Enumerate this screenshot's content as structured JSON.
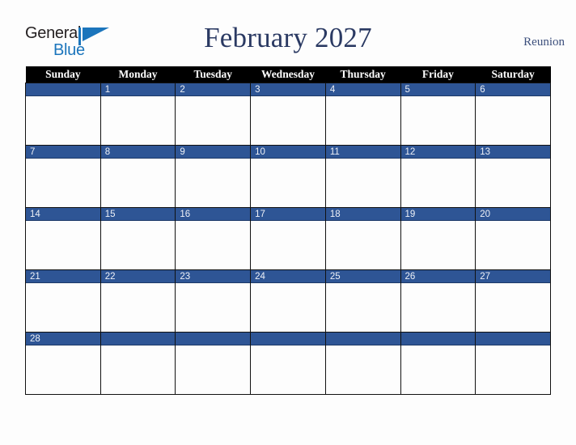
{
  "brand": {
    "word_one": "General",
    "word_two": "Blue",
    "triangle_icon": "triangle-icon",
    "color_dark": "#231f20",
    "color_blue": "#1b75bc"
  },
  "header": {
    "title": "February 2027",
    "month": "February",
    "year": "2027",
    "locale": "Reunion",
    "title_color": "#2b3a63"
  },
  "calendar": {
    "weekday_headers": [
      "Sunday",
      "Monday",
      "Tuesday",
      "Wednesday",
      "Thursday",
      "Friday",
      "Saturday"
    ],
    "header_bg": "#000000",
    "header_text_color": "#ffffff",
    "daynum_band_color": "#2e5595",
    "daynum_text_color": "#eef1f7",
    "cell_bg": "#fdfdfd",
    "border_color": "#111111",
    "weeks": [
      {
        "days": [
          {
            "label": ""
          },
          {
            "label": "1"
          },
          {
            "label": "2"
          },
          {
            "label": "3"
          },
          {
            "label": "4"
          },
          {
            "label": "5"
          },
          {
            "label": "6"
          }
        ]
      },
      {
        "days": [
          {
            "label": "7"
          },
          {
            "label": "8"
          },
          {
            "label": "9"
          },
          {
            "label": "10"
          },
          {
            "label": "11"
          },
          {
            "label": "12"
          },
          {
            "label": "13"
          }
        ]
      },
      {
        "days": [
          {
            "label": "14"
          },
          {
            "label": "15"
          },
          {
            "label": "16"
          },
          {
            "label": "17"
          },
          {
            "label": "18"
          },
          {
            "label": "19"
          },
          {
            "label": "20"
          }
        ]
      },
      {
        "days": [
          {
            "label": "21"
          },
          {
            "label": "22"
          },
          {
            "label": "23"
          },
          {
            "label": "24"
          },
          {
            "label": "25"
          },
          {
            "label": "26"
          },
          {
            "label": "27"
          }
        ]
      },
      {
        "days": [
          {
            "label": "28"
          },
          {
            "label": ""
          },
          {
            "label": ""
          },
          {
            "label": ""
          },
          {
            "label": ""
          },
          {
            "label": ""
          },
          {
            "label": ""
          }
        ]
      }
    ]
  }
}
